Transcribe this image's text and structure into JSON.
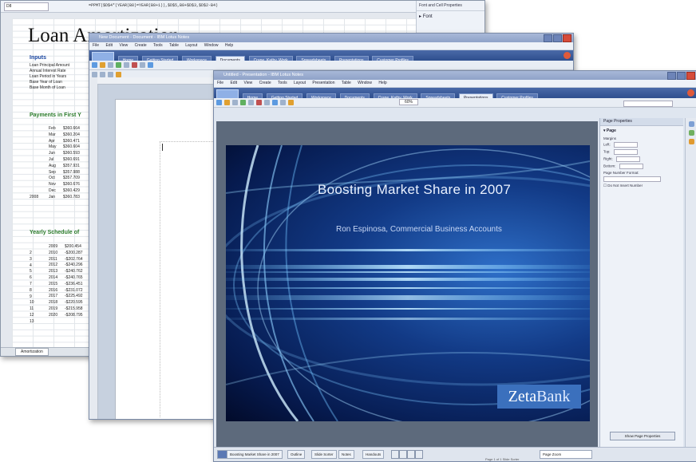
{
  "spreadsheet": {
    "formula": "=PPMT($D$4*(YEAR(B8)=YEAR(B8+1)),$D$5,B8+$D$3,$D$2-B4)",
    "title": "Loan Amortization",
    "inputs_header": "Inputs",
    "inputs": [
      "Loan Principal Amount",
      "Annual Interest Rate",
      "Loan Period in Years",
      "Base Year of Loan",
      "Base Month of Loan"
    ],
    "payments_header": "Payments in First Y",
    "months": [
      "Feb",
      "Mar",
      "Apr",
      "May",
      "Jun",
      "Jul",
      "Aug",
      "Sep",
      "Oct",
      "Nov",
      "Dec",
      "Jan"
    ],
    "month_values": [
      "$360.664",
      "$360.204",
      "$360.471",
      "$360.604",
      "$360.593",
      "$360.691",
      "$357.931",
      "$357.988",
      "$357.709",
      "$360.676",
      "$360.429",
      "$360.783"
    ],
    "year_marker": "2008",
    "yearly_header": "Yearly Schedule of",
    "year_col": [
      "2009",
      "2010",
      "2011",
      "2012",
      "2013",
      "2014",
      "2015",
      "2016",
      "2017",
      "2018",
      "2019",
      "2020"
    ],
    "year_values": [
      "$200.454",
      "-$200.287",
      "-$202.764",
      "-$240.296",
      "-$240.762",
      "-$240.765",
      "-$236.451",
      "-$231.072",
      "-$225.492",
      "-$220.595",
      "-$215.958",
      "-$208.795"
    ],
    "row_labels": [
      "1",
      "2",
      "3",
      "4",
      "5",
      "6",
      "7",
      "8",
      "9",
      "10",
      "11",
      "12",
      "13"
    ],
    "pane_title": "Font and Cell Properties",
    "pane_item": "Font",
    "sheet_tab": "Amortization"
  },
  "document": {
    "title": "New Document - Document - IBM Lotus Notes",
    "menus": [
      "File",
      "Edit",
      "View",
      "Create",
      "Tools",
      "Table",
      "Layout",
      "Window",
      "Help"
    ],
    "tabs": [
      "Home",
      "Getting Started",
      "Workspace",
      "Documents",
      "Crane, Kathy, Work",
      "Spreadsheets",
      "Presentations",
      "Customer Profiles"
    ]
  },
  "presentation": {
    "title": "Untitled - Presentation - IBM Lotus Notes",
    "menus": [
      "File",
      "Edit",
      "View",
      "Create",
      "Tools",
      "Layout",
      "Presentation",
      "Table",
      "Window",
      "Help"
    ],
    "tabs": [
      "Home",
      "Getting Started",
      "Workspace",
      "Documents",
      "Crane, Kathy, Work",
      "Spreadsheets",
      "Presentations",
      "Customer Profiles"
    ],
    "slide_title": "Boosting Market Share in 2007",
    "slide_subtitle": "Ron Espinosa, Commercial Business Accounts",
    "logo_part1": "Zeta",
    "logo_part2": "Bank",
    "zoom": "60%",
    "sidebar_title": "Page Properties",
    "sidebar_section": "Page",
    "sidebar_fields": [
      "Margins",
      "Left:",
      "Top:",
      "Right:",
      "Bottom:",
      "Page Number Format:"
    ],
    "sidebar_checkbox": "Do Not Insert Number",
    "sidebar_button": "Show Page Properties",
    "status_chips": [
      "Boosting Market Share in 2007",
      "Outline",
      "Slide Sorter",
      "Notes",
      "Handouts"
    ],
    "status_layout": "Page Zoom",
    "footer": "Page 1 of 1 Slide Sorter"
  },
  "colors": {
    "slide_bg": "#123a86",
    "logo_bg": "#3b70bd",
    "tab_strip": "#2f4f8e"
  }
}
